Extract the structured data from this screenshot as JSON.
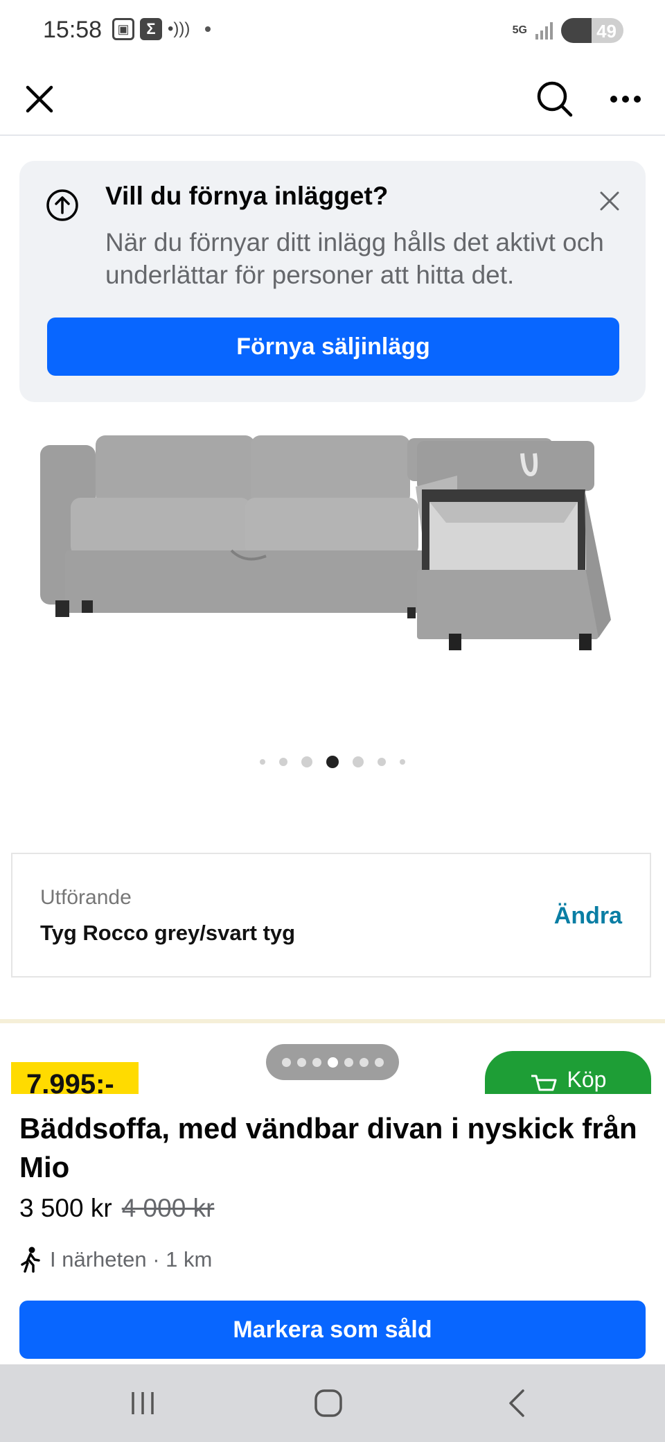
{
  "status_bar": {
    "time": "15:58",
    "network": "5G",
    "battery": "49",
    "battery_level_percent": 49
  },
  "nav": {
    "close_icon": "close-icon",
    "search_icon": "search-icon",
    "more_icon": "more-horizontal-icon"
  },
  "renew_card": {
    "title": "Vill du förnya inlägget?",
    "body": "När du förnyar ditt inlägg hålls det aktivt och underlättar för personer att hitta det.",
    "button_label": "Förnya säljinlägg",
    "icon": "arrow-up-circle-icon",
    "close_icon": "close-icon"
  },
  "carousel": {
    "total": 7,
    "active_index": 3
  },
  "photo_overlay": {
    "variant_label": "Utförande",
    "variant_value": "Tyg Rocco grey/svart tyg",
    "change_link": "Ändra",
    "price_tag": "7.995:-",
    "buy_label": "Köp",
    "image_counter_total": 7,
    "image_counter_active": 3
  },
  "listing": {
    "title": "Bäddsoffa, med vändbar divan i nyskick från Mio",
    "price": "3 500 kr",
    "original_price": "4 000 kr",
    "distance": "I närheten · 1 km",
    "mark_sold_label": "Markera som såld"
  },
  "colors": {
    "primary": "#0866ff",
    "card_bg": "#f0f2f5",
    "secondary_text": "#65676b",
    "price_tag": "#ffdb00",
    "buy_green": "#1e9e36"
  }
}
